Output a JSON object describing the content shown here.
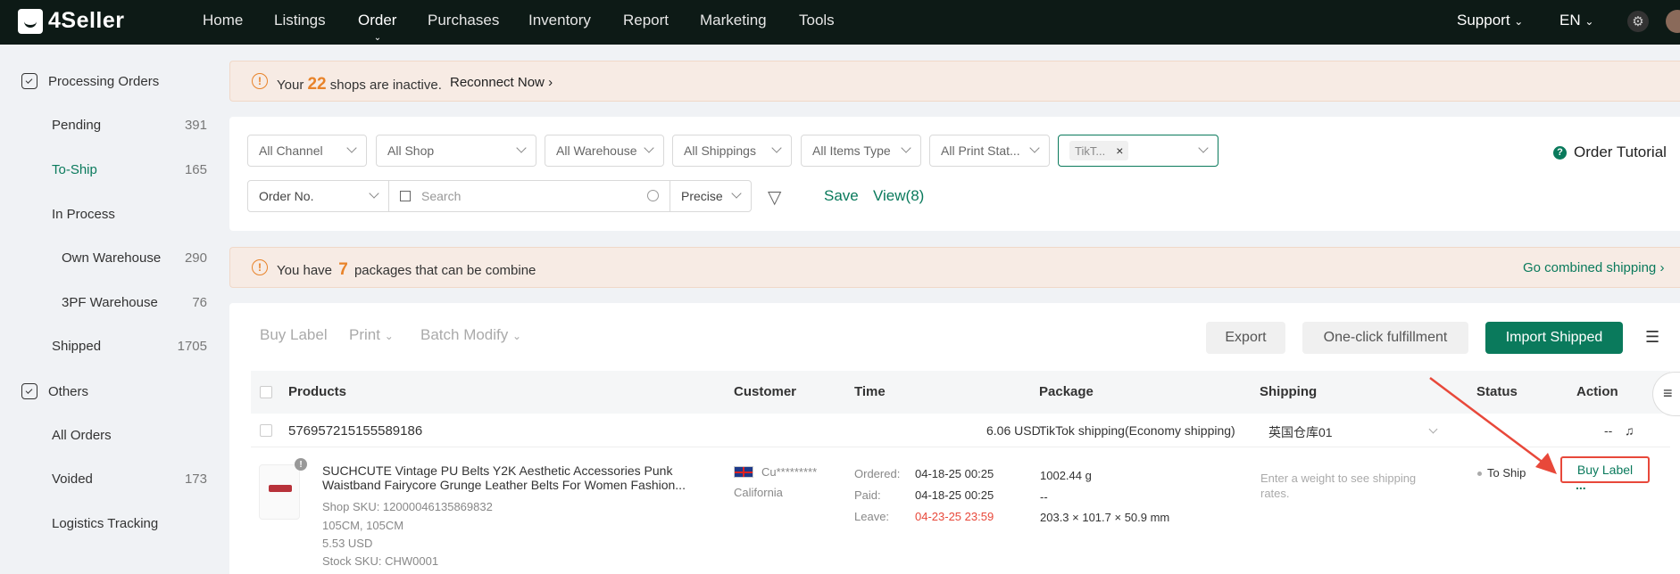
{
  "topbar": {
    "logo": "4Seller",
    "nav": [
      "Home",
      "Listings",
      "Order",
      "Purchases",
      "Inventory",
      "Report",
      "Marketing",
      "Tools"
    ],
    "support": "Support",
    "language": "EN"
  },
  "sidebar": {
    "group1": "Processing Orders",
    "items": [
      {
        "label": "Pending",
        "count": "391"
      },
      {
        "label": "To-Ship",
        "count": "165"
      },
      {
        "label": "In Process",
        "count": ""
      },
      {
        "label": "Own Warehouse",
        "count": "290"
      },
      {
        "label": "3PF Warehouse",
        "count": "76"
      },
      {
        "label": "Shipped",
        "count": "1705"
      }
    ],
    "group2": "Others",
    "others": [
      {
        "label": "All Orders",
        "count": ""
      },
      {
        "label": "Voided",
        "count": "173"
      },
      {
        "label": "Logistics Tracking",
        "count": ""
      }
    ]
  },
  "notice_shops": {
    "prefix": "Your",
    "count": "22",
    "suffix": "shops are inactive.",
    "action": "Reconnect Now"
  },
  "filters": {
    "channel": "All Channel",
    "shop": "All Shop",
    "warehouse": "All Warehouse",
    "shippings": "All Shippings",
    "items_type": "All Items Type",
    "print_status": "All Print Stat...",
    "tag": "TikT...",
    "tutorial": "Order Tutorial",
    "search_field": "Order No.",
    "search_placeholder": "Search",
    "match": "Precise",
    "save": "Save",
    "view": "View(8)"
  },
  "notice_packages": {
    "prefix": "You have",
    "count": "7",
    "suffix": "packages that can be combine",
    "action": "Go combined shipping"
  },
  "toolbar": {
    "buy_label": "Buy Label",
    "print": "Print",
    "batch_modify": "Batch Modify",
    "export": "Export",
    "one_click": "One-click fulfillment",
    "import_shipped": "Import Shipped"
  },
  "table": {
    "headers": [
      "Products",
      "Customer",
      "Time",
      "Package",
      "Shipping",
      "Status",
      "Action"
    ],
    "order": {
      "order_no": "576957215155589186",
      "amount": "6.06 USD",
      "shipping_method": "TikTok shipping(Economy shipping)",
      "warehouse": "英国仓库01",
      "dash": "--",
      "product_title_1": "SUCHCUTE Vintage PU Belts Y2K Aesthetic Accessories Punk",
      "product_title_2": "Waistband Fairycore Grunge Leather Belts For Women Fashion...",
      "shop_sku": "Shop SKU: 12000046135869832",
      "variant": "105CM, 105CM",
      "price": "5.53 USD",
      "stock_sku": "Stock SKU: CHW0001",
      "customer": "Cu*********",
      "region": "California",
      "ordered_label": "Ordered:",
      "ordered": "04-18-25 00:25",
      "paid_label": "Paid:",
      "paid": "04-18-25 00:25",
      "leave_label": "Leave:",
      "leave": "04-23-25 23:59",
      "weight": "1002.44 g",
      "pkg_dash": "--",
      "dims": "203.3 × 101.7 × 50.9 mm",
      "shipping_hint_1": "Enter a weight to see shipping",
      "shipping_hint_2": "rates.",
      "status": "To Ship",
      "action": "Buy Label",
      "more": "..."
    }
  },
  "colors": {
    "brand": "#0a7a5c",
    "topbar": "#0d1a16",
    "warning": "#e8832a",
    "alert": "#e8483a"
  }
}
